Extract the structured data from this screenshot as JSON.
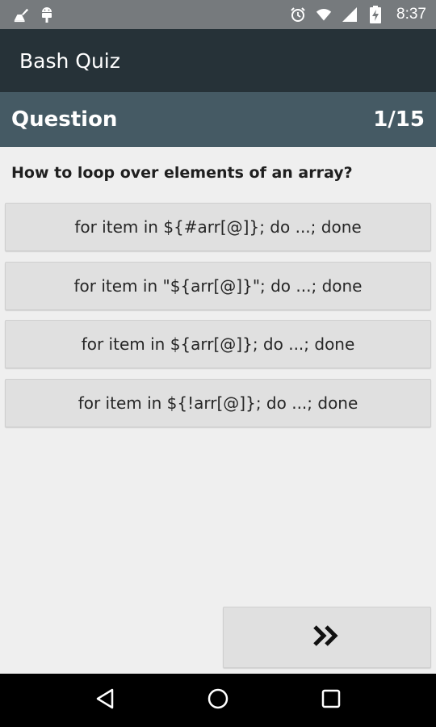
{
  "status_bar": {
    "time": "8:37",
    "icons": [
      "cleaner-icon",
      "android-icon",
      "alarm-icon",
      "wifi-icon",
      "signal-icon",
      "battery-charging-icon"
    ]
  },
  "app_bar": {
    "title": "Bash Quiz"
  },
  "question_header": {
    "label": "Question",
    "progress": "1/15"
  },
  "question": {
    "text": "How to loop over elements of an array?"
  },
  "answers": [
    {
      "label": "for item in ${#arr[@]}; do ...; done"
    },
    {
      "label": "for item in \"${arr[@]}\"; do ...; done"
    },
    {
      "label": "for item in ${arr[@]}; do ...; done"
    },
    {
      "label": "for item in ${!arr[@]}; do ...; done"
    }
  ],
  "next_button": {
    "icon": "double-chevron-right-icon"
  },
  "nav_bar": {
    "icons": [
      "back-icon",
      "home-icon",
      "recents-icon"
    ]
  },
  "colors": {
    "status_bar": "#767a7d",
    "app_bar": "#263238",
    "question_header": "#455a64",
    "background": "#efefef",
    "button": "#e0e0e0"
  }
}
